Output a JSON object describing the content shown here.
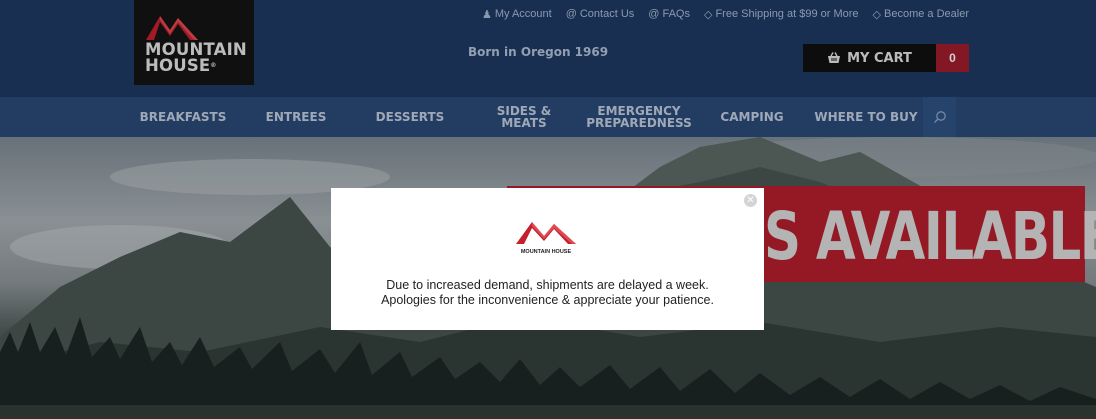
{
  "brand": {
    "name_line1": "MOUNTAIN",
    "name_line2": "HOUSE",
    "tm": "®",
    "modal_name": "MOUNTAIN HOUSE"
  },
  "top_links": [
    {
      "icon": "user-icon",
      "label": "My Account"
    },
    {
      "icon": "at-icon",
      "label": "Contact Us"
    },
    {
      "icon": "at-icon",
      "label": "FAQs"
    },
    {
      "icon": "tag-icon",
      "label": "Free Shipping at $99 or More"
    },
    {
      "icon": "tag-icon",
      "label": "Become a Dealer"
    }
  ],
  "tagline": "Born in Oregon 1969",
  "cart": {
    "label": "MY CART",
    "count": "0",
    "icon": "basket-icon"
  },
  "nav": [
    {
      "label": "BREAKFASTS"
    },
    {
      "label": "ENTREES"
    },
    {
      "label": "DESSERTS"
    },
    {
      "label": "SIDES & MEATS"
    },
    {
      "label": "EMERGENCY PREPAREDNESS"
    },
    {
      "label": "CAMPING"
    },
    {
      "label": "WHERE TO BUY"
    }
  ],
  "hero": {
    "banner_text": "S AVAILABLE"
  },
  "modal": {
    "message_line1": "Due to increased demand, shipments are delayed a week.",
    "message_line2": "Apologies for the inconvenience & appreciate your patience."
  },
  "colors": {
    "header": "#1f3a64",
    "nav": "#2a4a78",
    "brand_red": "#b51f2d",
    "cart": "#111111",
    "cart_count": "#a11d2c"
  }
}
